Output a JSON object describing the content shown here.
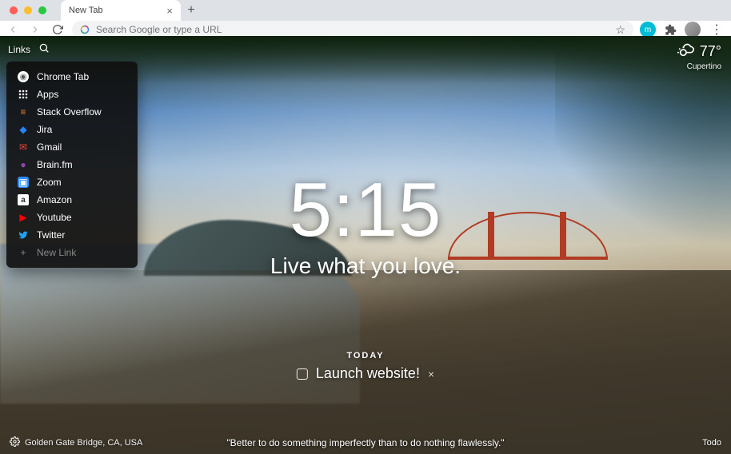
{
  "browser": {
    "tab_title": "New Tab",
    "omnibox_placeholder": "Search Google or type a URL"
  },
  "links": {
    "button_label": "Links",
    "items": [
      {
        "label": "Chrome Tab",
        "icon": "chrome"
      },
      {
        "label": "Apps",
        "icon": "apps"
      },
      {
        "label": "Stack Overflow",
        "icon": "stackoverflow"
      },
      {
        "label": "Jira",
        "icon": "jira"
      },
      {
        "label": "Gmail",
        "icon": "gmail"
      },
      {
        "label": "Brain.fm",
        "icon": "brainfm"
      },
      {
        "label": "Zoom",
        "icon": "zoom"
      },
      {
        "label": "Amazon",
        "icon": "amazon"
      },
      {
        "label": "Youtube",
        "icon": "youtube"
      },
      {
        "label": "Twitter",
        "icon": "twitter"
      }
    ],
    "new_link_label": "New Link"
  },
  "weather": {
    "temperature": "77°",
    "location": "Cupertino"
  },
  "center": {
    "time": "5:15",
    "mantra": "Live what you love."
  },
  "todo": {
    "header": "TODAY",
    "item": "Launch website!"
  },
  "bottom": {
    "photo_info": "Golden Gate Bridge, CA, USA",
    "quote": "\"Better to do something imperfectly than to do nothing flawlessly.\"",
    "todo_label": "Todo"
  }
}
